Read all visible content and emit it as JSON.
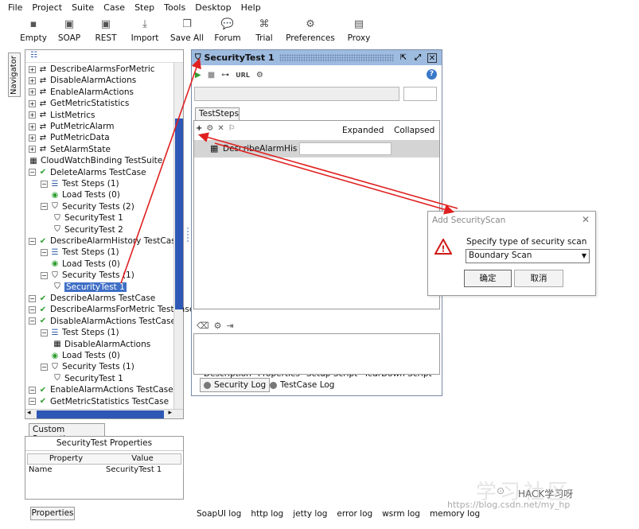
{
  "menu": [
    "File",
    "Project",
    "Suite",
    "Case",
    "Step",
    "Tools",
    "Desktop",
    "Help"
  ],
  "toolbar": [
    {
      "label": "Empty",
      "icon": "empty-project-icon",
      "glyph": "▪"
    },
    {
      "label": "SOAP",
      "icon": "soap-icon",
      "glyph": "▣"
    },
    {
      "label": "REST",
      "icon": "rest-icon",
      "glyph": "▣"
    },
    {
      "label": "Import",
      "icon": "import-icon",
      "glyph": "⤓"
    },
    {
      "label": "Save All",
      "icon": "save-all-icon",
      "glyph": "❐"
    },
    {
      "label": "Forum",
      "icon": "forum-icon",
      "glyph": "💬"
    },
    {
      "label": "Trial",
      "icon": "trial-icon",
      "glyph": "⌘"
    },
    {
      "label": "Preferences",
      "icon": "preferences-gear-icon",
      "glyph": "⚙"
    },
    {
      "label": "Proxy",
      "icon": "proxy-icon",
      "glyph": "▤"
    }
  ],
  "navigator_tab": "Navigator",
  "tree": [
    {
      "label": "DescribeAlarmsForMetric",
      "level": 0,
      "icon": "⇄"
    },
    {
      "label": "DisableAlarmActions",
      "level": 0,
      "icon": "⇄"
    },
    {
      "label": "EnableAlarmActions",
      "level": 0,
      "icon": "⇄"
    },
    {
      "label": "GetMetricStatistics",
      "level": 0,
      "icon": "⇄"
    },
    {
      "label": "ListMetrics",
      "level": 0,
      "icon": "⇄"
    },
    {
      "label": "PutMetricAlarm",
      "level": 0,
      "icon": "⇄"
    },
    {
      "label": "PutMetricData",
      "level": 0,
      "icon": "⇄"
    },
    {
      "label": "SetAlarmState",
      "level": 0,
      "icon": "⇄"
    },
    {
      "label": "CloudWatchBinding TestSuite",
      "level": -1,
      "icon": "▦"
    },
    {
      "label": "DeleteAlarms TestCase",
      "level": 0,
      "icon": "✔"
    },
    {
      "label": "Test Steps (1)",
      "level": 1,
      "icon": "☰"
    },
    {
      "label": "Load Tests (0)",
      "level": 1,
      "icon": "◉"
    },
    {
      "label": "Security Tests (2)",
      "level": 1,
      "icon": "⛉"
    },
    {
      "label": "SecurityTest 1",
      "level": 2,
      "icon": "⛉"
    },
    {
      "label": "SecurityTest 2",
      "level": 2,
      "icon": "⛉"
    },
    {
      "label": "DescribeAlarmHistory TestCase",
      "level": 0,
      "icon": "✔"
    },
    {
      "label": "Test Steps (1)",
      "level": 1,
      "icon": "☰"
    },
    {
      "label": "Load Tests (0)",
      "level": 1,
      "icon": "◉"
    },
    {
      "label": "Security Tests (1)",
      "level": 1,
      "icon": "⛉"
    },
    {
      "label": "SecurityTest 1",
      "level": 2,
      "icon": "⛉",
      "selected": true
    },
    {
      "label": "DescribeAlarms TestCase",
      "level": 0,
      "icon": "✔"
    },
    {
      "label": "DescribeAlarmsForMetric TestCase",
      "level": 0,
      "icon": "✔"
    },
    {
      "label": "DisableAlarmActions TestCase",
      "level": 0,
      "icon": "✔"
    },
    {
      "label": "Test Steps (1)",
      "level": 1,
      "icon": "☰"
    },
    {
      "label": "DisableAlarmActions",
      "level": 2,
      "icon": "▦"
    },
    {
      "label": "Load Tests (0)",
      "level": 1,
      "icon": "◉"
    },
    {
      "label": "Security Tests (1)",
      "level": 1,
      "icon": "⛉"
    },
    {
      "label": "SecurityTest 1",
      "level": 2,
      "icon": "⛉"
    },
    {
      "label": "EnableAlarmActions TestCase",
      "level": 0,
      "icon": "✔"
    },
    {
      "label": "GetMetricStatistics TestCase",
      "level": 0,
      "icon": "✔"
    }
  ],
  "custom_properties": {
    "tab": "Custom Properties",
    "title": "SecurityTest Properties",
    "col_property": "Property",
    "col_value": "Value",
    "row_name": "Name",
    "row_value": "SecurityTest 1",
    "button": "Properties"
  },
  "security_test": {
    "title": "SecurityTest 1",
    "toolbar_icons": [
      "run-icon",
      "stop-icon",
      "options-icon",
      "url-icon",
      "settings-gear-icon"
    ],
    "url_label": "URL",
    "steps_tab": "TestSteps",
    "col_expanded": "Expanded",
    "col_collapsed": "Collapsed",
    "step_name": "DescribeAlarmHis",
    "bottom_tabs": [
      "Description",
      "Properties",
      "Setup Script",
      "TearDown Script"
    ],
    "log_tabs": [
      "Security Log",
      "TestCase Log"
    ]
  },
  "dialog": {
    "title": "Add SecurityScan",
    "prompt": "Specify type of security scan",
    "selected": "Boundary Scan",
    "ok": "确定",
    "cancel": "取消"
  },
  "bottom_logs": [
    "SoapUI log",
    "http log",
    "jetty log",
    "error log",
    "wsrm log",
    "memory log"
  ],
  "watermark": {
    "big": "学习社区",
    "name": "HACK学习呀",
    "url": "https://blog.csdn.net/my_hp"
  },
  "colors": {
    "selection": "#3f6fc6",
    "titlebar": "#9ebbe0",
    "check": "#2f9e2f",
    "arrow": "#e02020",
    "scroll_thumb": "#2e57b6"
  }
}
